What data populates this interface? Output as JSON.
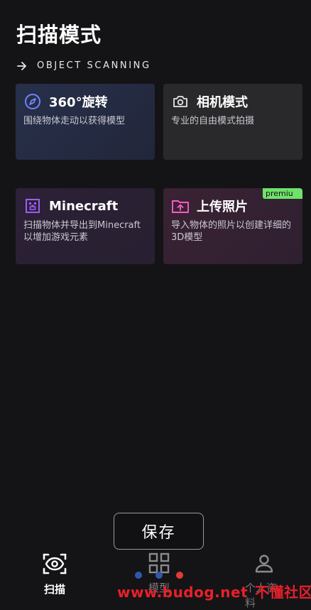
{
  "header": {
    "title": "扫描模式",
    "subtitle": "OBJECT SCANNING"
  },
  "cards": [
    {
      "name": "360°旋转",
      "desc": "围绕物体走动以获得模型",
      "icon": "compass-icon"
    },
    {
      "name": "相机模式",
      "desc": "专业的自由模式拍摄",
      "icon": "camera-icon"
    },
    {
      "name": "Minecraft",
      "desc": "扫描物体并导出到Minecraft以增加游戏元素",
      "icon": "minecraft-icon"
    },
    {
      "name": "上传照片",
      "desc": "导入物体的照片以创建详细的3D模型",
      "icon": "upload-folder-icon",
      "badge": "premiu"
    }
  ],
  "save_button": {
    "label": "保存"
  },
  "nav": {
    "items": [
      {
        "label": "扫描",
        "icon": "eye-scan-icon",
        "active": true
      },
      {
        "label": "模型",
        "icon": "grid-icon"
      },
      {
        "label": "个人资料",
        "icon": "person-icon"
      }
    ]
  },
  "watermark": {
    "url": "www.budog.net",
    "text": "不懂社区"
  },
  "colors": {
    "background": "#141416",
    "accent_blue": "#6f84ff",
    "accent_purple": "#9b5cff",
    "accent_pink": "#ff5ac8",
    "premium_green": "#6ee26a",
    "watermark_red": "#e8202a"
  }
}
